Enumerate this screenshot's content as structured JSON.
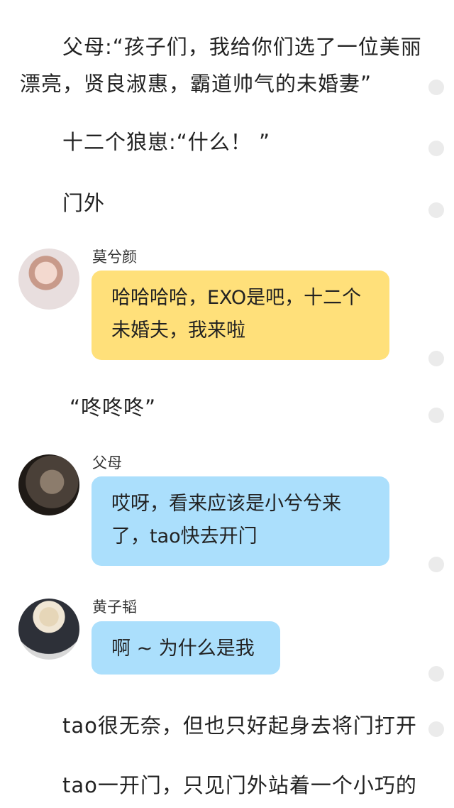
{
  "paragraphs": [
    "父母:“孩子们，我给你们选了一位美丽漂亮，贤良淑惠，霸道帅气的未婚妻”",
    "十二个狼崽:“什么！ ”",
    "门外",
    "“咚咚咚”",
    "tao很无奈，但也只好起身去将门打开",
    "tao一开门，只见门外站着一个小巧的"
  ],
  "messages": [
    {
      "sender": "莫兮颜",
      "text": "哈哈哈哈，EXO是吧，十二个未婚夫，我来啦",
      "color": "#ffe07a"
    },
    {
      "sender": "父母",
      "text": "哎呀，看来应该是小兮兮来了，tao快去开门",
      "color": "#abdffc"
    },
    {
      "sender": "黄子韬",
      "text": "啊 ~ 为什么是我",
      "color": "#abdffc"
    }
  ],
  "colors": {
    "dot": "#ebebeb",
    "bubble_yellow": "#ffe07a",
    "bubble_blue": "#abdffc"
  }
}
